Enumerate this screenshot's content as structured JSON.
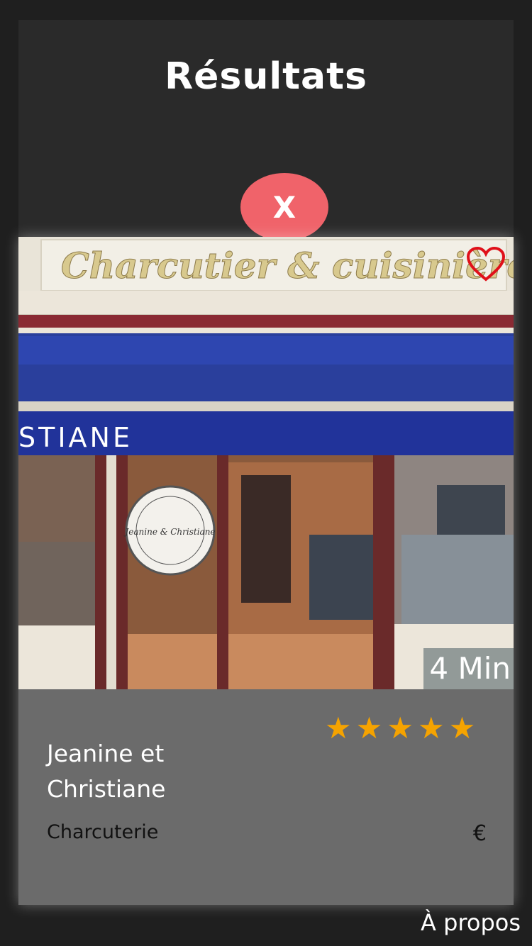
{
  "header": {
    "title": "Résultats"
  },
  "close_button": {
    "label": "X"
  },
  "card": {
    "image_alt": "",
    "sign_text": "Charcutier & cuisinière",
    "awning_text": "STIANE",
    "door_logo": "Jeanine & Christiane",
    "time_badge": "4 Min",
    "rating": 5,
    "stars": [
      "★",
      "★",
      "★",
      "★",
      "★"
    ],
    "name": "Jeanine et Christiane",
    "category": "Charcuterie",
    "price": "€"
  },
  "footer": {
    "link_label": "À propos"
  },
  "colors": {
    "background": "#1f1f1f",
    "panel": "#2a2a2a",
    "close_button": "#f0636a",
    "card_info": "#6b6b6b",
    "star": "#f5a300",
    "favorite": "#e0101a"
  }
}
